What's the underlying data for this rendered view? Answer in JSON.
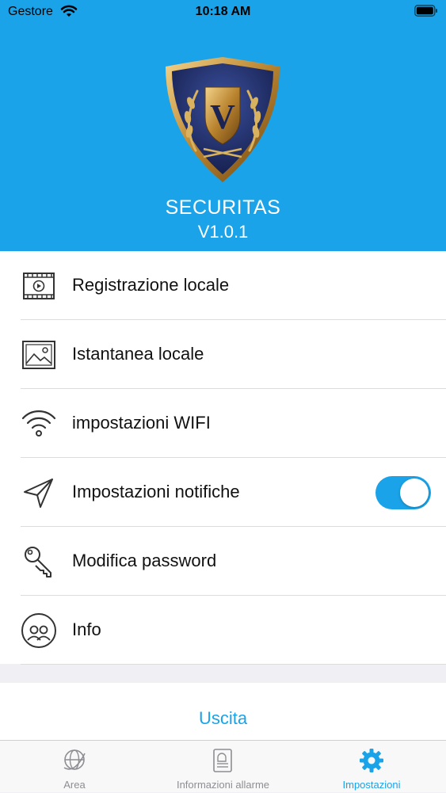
{
  "status_bar": {
    "carrier": "Gestore",
    "time": "10:18 AM"
  },
  "header": {
    "logo_letter": "V",
    "app_name": "SECURITAS",
    "version": "V1.0.1"
  },
  "menu": {
    "items": [
      {
        "label": "Registrazione locale",
        "icon": "video-recording-icon"
      },
      {
        "label": "Istantanea locale",
        "icon": "image-icon"
      },
      {
        "label": "impostazioni WIFI",
        "icon": "wifi-icon"
      },
      {
        "label": "Impostazioni notifiche",
        "icon": "paper-plane-icon",
        "toggle": true
      },
      {
        "label": "Modifica password",
        "icon": "key-icon"
      },
      {
        "label": "Info",
        "icon": "users-circle-icon"
      }
    ]
  },
  "logout_label": "Uscita",
  "tabbar": {
    "tabs": [
      {
        "label": "Area",
        "icon": "globe-icon",
        "active": false
      },
      {
        "label": "Informazioni allarme",
        "icon": "alarm-document-icon",
        "active": false
      },
      {
        "label": "Impostazioni",
        "icon": "gear-icon",
        "active": true
      }
    ]
  },
  "colors": {
    "accent": "#1aa3e8",
    "inactive": "#8e8e93"
  }
}
